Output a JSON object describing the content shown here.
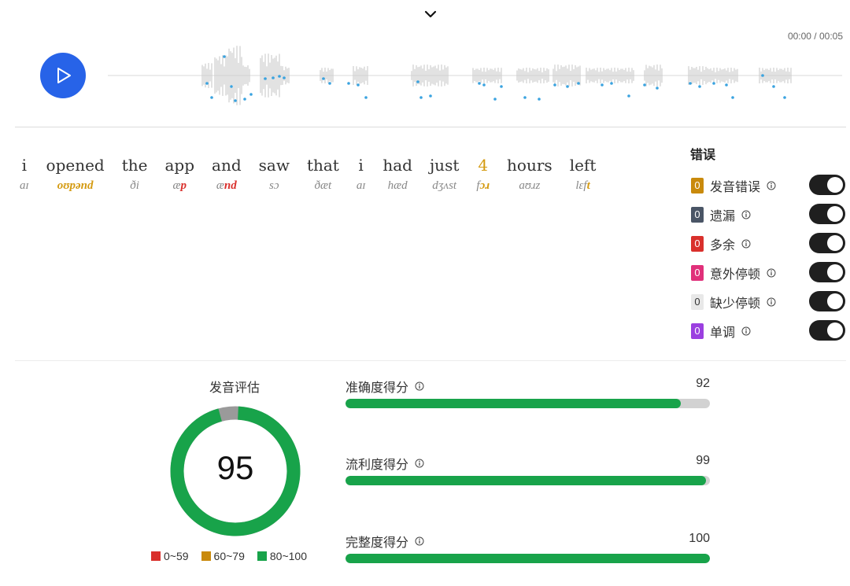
{
  "player": {
    "time": "00:00 / 00:05",
    "progress": 0
  },
  "words": [
    {
      "word": "i",
      "phoneme": "aɪ",
      "segments": [
        {
          "t": "aɪ",
          "err": ""
        }
      ]
    },
    {
      "word": "opened",
      "phoneme": "oʊpənd",
      "segments": [
        {
          "t": "oʊpənd",
          "err": "y"
        }
      ]
    },
    {
      "word": "the",
      "phoneme": "ði",
      "segments": [
        {
          "t": "ði",
          "err": ""
        }
      ]
    },
    {
      "word": "app",
      "phoneme": "æp",
      "segments": [
        {
          "t": "æ",
          "err": ""
        },
        {
          "t": "p",
          "err": "r"
        }
      ]
    },
    {
      "word": "and",
      "phoneme": "ænd",
      "segments": [
        {
          "t": "æ",
          "err": ""
        },
        {
          "t": "nd",
          "err": "r"
        }
      ]
    },
    {
      "word": "saw",
      "phoneme": "sɔ",
      "segments": [
        {
          "t": "sɔ",
          "err": ""
        }
      ]
    },
    {
      "word": "that",
      "phoneme": "ðæt",
      "segments": [
        {
          "t": "ðæt",
          "err": ""
        }
      ]
    },
    {
      "word": "i",
      "phoneme": "aɪ",
      "segments": [
        {
          "t": "aɪ",
          "err": ""
        }
      ]
    },
    {
      "word": "had",
      "phoneme": "hæd",
      "segments": [
        {
          "t": "hæd",
          "err": ""
        }
      ]
    },
    {
      "word": "just",
      "phoneme": "dʒʌst",
      "segments": [
        {
          "t": "dʒʌst",
          "err": ""
        }
      ]
    },
    {
      "word": "4",
      "phoneme": "fɔɹ",
      "segments": [
        {
          "t": "f",
          "err": ""
        },
        {
          "t": "ɔɹ",
          "err": "y"
        }
      ]
    },
    {
      "word": "hours",
      "phoneme": "aʊɹz",
      "segments": [
        {
          "t": "aʊɹz",
          "err": ""
        }
      ]
    },
    {
      "word": "left",
      "phoneme": "lɛft",
      "segments": [
        {
          "t": "lɛf",
          "err": ""
        },
        {
          "t": "t",
          "err": "y"
        }
      ]
    }
  ],
  "errors": {
    "title": "错误",
    "items": [
      {
        "label": "发音错误",
        "count": "0",
        "color": "#c98a0c",
        "on": true
      },
      {
        "label": "遗漏",
        "count": "0",
        "color": "#4a5566",
        "on": true
      },
      {
        "label": "多余",
        "count": "0",
        "color": "#d9302c",
        "on": true
      },
      {
        "label": "意外停顿",
        "count": "0",
        "color": "#e0307a",
        "on": true
      },
      {
        "label": "缺少停顿",
        "count": "0",
        "color": "#e8e8e8",
        "on": true
      },
      {
        "label": "单调",
        "count": "0",
        "color": "#9b3fe0",
        "on": true
      }
    ]
  },
  "assessment": {
    "title": "发音评估",
    "score": "95",
    "score_value": 95,
    "legend": [
      {
        "label": "0~59",
        "color": "#d9302c"
      },
      {
        "label": "60~79",
        "color": "#c98a0c"
      },
      {
        "label": "80~100",
        "color": "#18a34a"
      }
    ],
    "bars": [
      {
        "label": "准确度得分",
        "value": "92",
        "score": 92
      },
      {
        "label": "流利度得分",
        "value": "99",
        "score": 99
      },
      {
        "label": "完整度得分",
        "value": "100",
        "score": 100
      }
    ]
  }
}
